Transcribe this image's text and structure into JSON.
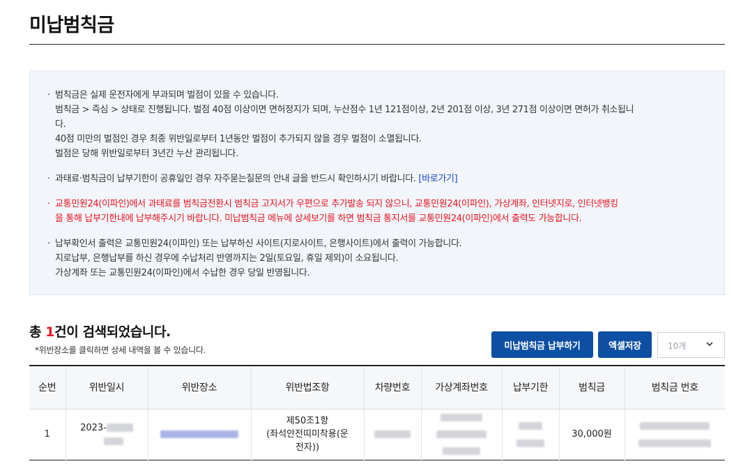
{
  "page": {
    "title": "미납범칙금"
  },
  "notice": {
    "items": [
      {
        "lines": [
          "범칙금은 실제 운전자에게 부과되며 벌점이 있을 수 있습니다.",
          "범칙금 > 즉심 > 상태로 진행됩니다. 벌점 40점 이상이면 면허정지가 되며, 누산점수 1년 121점이상, 2년 201점 이상, 3년 271점 이상이면 면허가 취소됩니",
          "다.",
          "40점 미만의 벌점인 경우 최종 위반일로부터 1년동안 벌점이 추가되지 않을 경우 벌점이 소멸됩니다.",
          "벌점은 당해 위반일로부터 3년간 누산 관리됩니다."
        ]
      },
      {
        "text": "과태료·범칙금이 납부기한이 공휴일인 경우 자주묻는질문의 안내 글을 반드시 확인하시기 바랍니다.",
        "link": "[바로가기]"
      },
      {
        "lines": [
          "교통민원24(이파인)에서 과태료를 범칙금전환시 범칙금 고지서가 우편으로 추가발송 되지 않으니, 교통민원24(이파인), 가상계좌, 인터넷지로, 인터넷뱅킹",
          "을 통해 납부기한내에 납부해주시기 바랍니다. 미납범칙금 메뉴에 상세보기를 하면 범칙금 통지서를 교통민원24(이파인)에서 출력도 가능합니다."
        ]
      },
      {
        "lines": [
          "납부확인서 출력은 교통민원24(이파인) 또는 납부하신 사이트(지로사이트, 은행사이트)에서 출력이 가능합니다.",
          "지로납부, 은행납부를 하신 경우에 수납처리 반영까지는 2일(토요일, 휴일 제외)이 소요됩니다.",
          "가상계좌 또는 교통민원24(이파인)에서 수납한 경우 당일 반영됩니다."
        ]
      }
    ],
    "bullet": "·"
  },
  "results": {
    "count_prefix": "총 ",
    "count_value": "1",
    "count_suffix": "건이 검색되었습니다.",
    "hint": "*위반장소를 클릭하면 상세 내역을 볼 수 있습니다."
  },
  "toolbar": {
    "pay_label": "미납범칙금 납부하기",
    "excel_label": "엑셀저장",
    "page_size_value": "10개"
  },
  "table": {
    "headers": [
      "순번",
      "위반일시",
      "위반장소",
      "위반법조항",
      "차량번호",
      "가상계좌번호",
      "납부기한",
      "범칙금",
      "범칙금 번호"
    ],
    "rows": [
      {
        "seq": "1",
        "date_prefix": "2023-",
        "law_line1": "제50조1항",
        "law_line2": "(좌석안전띠미착용(운",
        "law_line3": "전자))",
        "amount": "30,000원"
      }
    ]
  },
  "colors": {
    "accent": "#0d4fa3",
    "highlight_red": "#e8131f",
    "link_blue": "#1546c9",
    "notice_bg": "#f2f6fb"
  }
}
